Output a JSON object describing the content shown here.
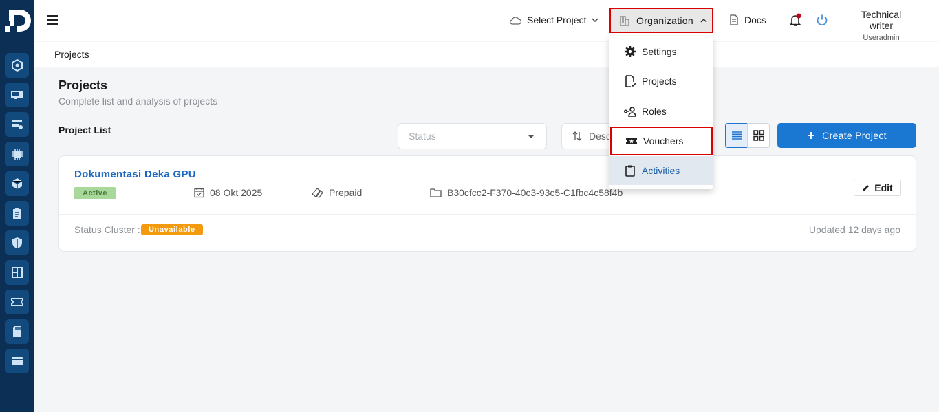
{
  "topbar": {
    "select_project": "Select Project",
    "organization": "Organization",
    "docs": "Docs",
    "user_name": "Technical writer",
    "user_role": "Useradmin"
  },
  "breadcrumb": "Projects",
  "page": {
    "title": "Projects",
    "subtitle": "Complete list and analysis of projects",
    "list_label": "Project List"
  },
  "filters": {
    "status_placeholder": "Status",
    "sort_label": "Desc"
  },
  "create_button": "Create Project",
  "project": {
    "name": "Dokumentasi Deka GPU",
    "status": "Active",
    "date": "08 Okt 2025",
    "billing": "Prepaid",
    "id": "B30cfcc2-F370-40c3-93c5-C1fbc4c58f4b",
    "edit_label": "Edit",
    "cluster_label": "Status Cluster :",
    "cluster_status": "Unavailable",
    "updated": "Updated 12 days ago"
  },
  "org_menu": [
    {
      "label": "Settings",
      "icon": "gear-icon"
    },
    {
      "label": "Projects",
      "icon": "document-check-icon"
    },
    {
      "label": "Roles",
      "icon": "user-key-icon"
    },
    {
      "label": "Vouchers",
      "icon": "ticket-icon"
    },
    {
      "label": "Activities",
      "icon": "clipboard-icon"
    }
  ],
  "colors": {
    "sidebar": "#0b2f55",
    "accent": "#1b78d2",
    "highlight_border": "#d90000",
    "active_badge": "#a8d89a",
    "unavailable_badge": "#f39a0f"
  }
}
